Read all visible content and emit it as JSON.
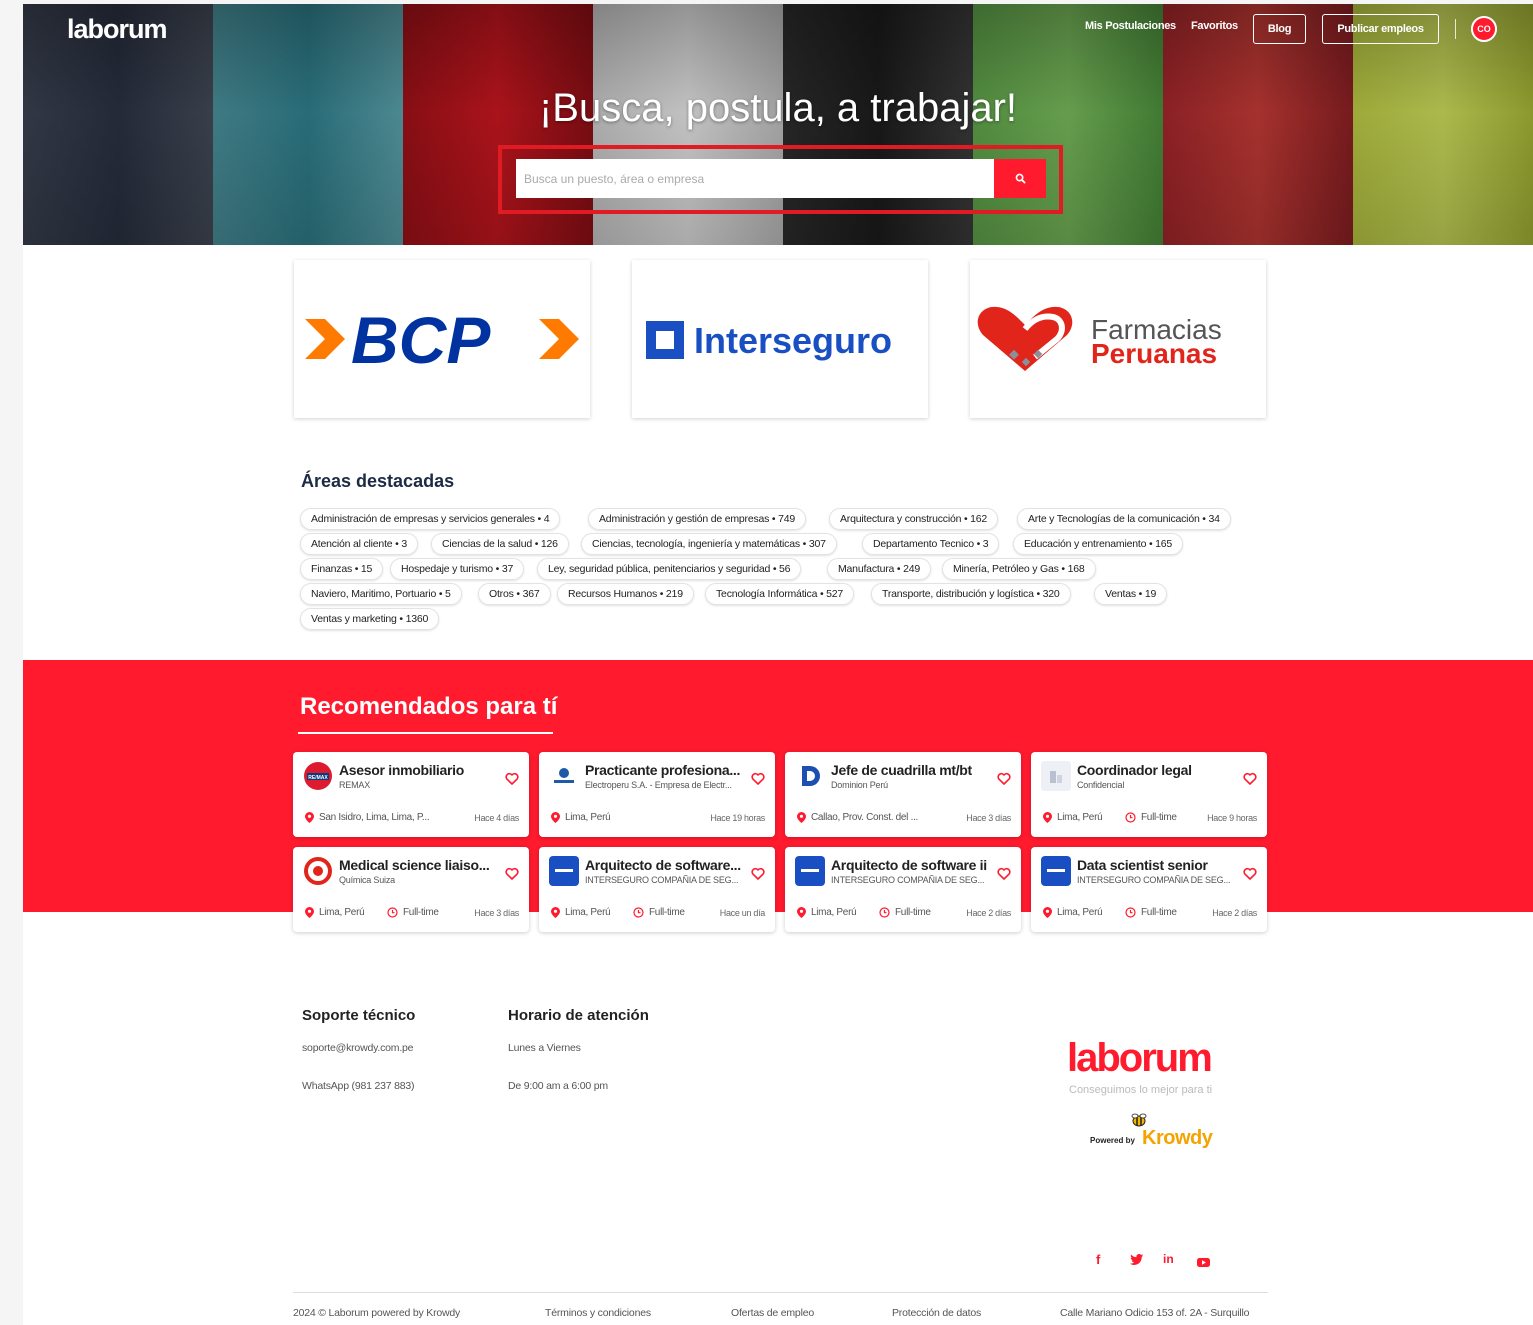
{
  "brand": {
    "name": "laborum",
    "tagline": "Conseguimos lo mejor para ti",
    "powered_by": "Powered by",
    "krowdy": "Krowdy"
  },
  "nav": {
    "applications": "Mis Postulaciones",
    "favorites": "Favoritos",
    "blog": "Blog",
    "publish": "Publicar empleos",
    "avatar_initials": "CO"
  },
  "hero": {
    "title": "¡Busca, postula, a trabajar!",
    "search_placeholder": "Busca un puesto, área o empresa"
  },
  "companies": [
    {
      "name": "BCP",
      "color": "#0033a0",
      "accent": "#ff7a00"
    },
    {
      "name": "Interseguro",
      "color": "#1a4fc4"
    },
    {
      "name_line1": "Farmacias",
      "name_line2": "Peruanas",
      "color": "#e1251b",
      "text_color": "#555555"
    }
  ],
  "areas": {
    "title": "Áreas destacadas",
    "items": [
      "Administración de empresas y servicios generales • 4",
      "Administración y gestión de empresas • 749",
      "Arquitectura y construcción • 162",
      "Arte y Tecnologías de la comunicación • 34",
      "Atención al cliente • 3",
      "Ciencias de la salud • 126",
      "Ciencias, tecnología, ingeniería y matemáticas • 307",
      "Departamento Tecnico • 3",
      "Educación y entrenamiento • 165",
      "Finanzas • 15",
      "Hospedaje y turismo • 37",
      "Ley, seguridad pública, penitenciarios y seguridad • 56",
      "Manufactura • 249",
      "Minería, Petróleo y Gas • 168",
      "Naviero, Maritimo, Portuario • 5",
      "Otros • 367",
      "Recursos Humanos • 219",
      "Tecnología Informática • 527",
      "Transporte, distribución y logística • 320",
      "Ventas • 19",
      "Ventas y marketing • 1360"
    ]
  },
  "recommended": {
    "title": "Recomendados para tí",
    "jobs": [
      {
        "title": "Asesor inmobiliario",
        "company": "REMAX",
        "location": "San Isidro, Lima, Lima, P...",
        "type": "",
        "posted": "Hace 4 días",
        "logo": "remax"
      },
      {
        "title": "Practicante profesiona...",
        "company": "Electroperu S.A. - Empresa de Electr...",
        "location": "Lima, Perú",
        "type": "",
        "posted": "Hace 19 horas",
        "logo": "electroperu"
      },
      {
        "title": "Jefe de cuadrilla mt/bt",
        "company": "Dominion Perú",
        "location": "Callao, Prov. Const. del ...",
        "type": "",
        "posted": "Hace 3 días",
        "logo": "dominion"
      },
      {
        "title": "Coordinador legal",
        "company": "Confidencial",
        "location": "Lima, Perú",
        "type": "Full-time",
        "posted": "Hace 9 horas",
        "logo": "confidencial"
      },
      {
        "title": "Medical science liaiso...",
        "company": "Química Suiza",
        "location": "Lima, Perú",
        "type": "Full-time",
        "posted": "Hace 3 días",
        "logo": "quimica"
      },
      {
        "title": "Arquitecto de software...",
        "company": "INTERSEGURO COMPAÑIA DE SEG...",
        "location": "Lima, Perú",
        "type": "Full-time",
        "posted": "Hace un día",
        "logo": "interseguro"
      },
      {
        "title": "Arquitecto de software ii",
        "company": "INTERSEGURO COMPAÑIA DE SEG...",
        "location": "Lima, Perú",
        "type": "Full-time",
        "posted": "Hace 2 días",
        "logo": "interseguro"
      },
      {
        "title": "Data scientist senior",
        "company": "INTERSEGURO COMPAÑIA DE SEG...",
        "location": "Lima, Perú",
        "type": "Full-time",
        "posted": "Hace 2 días",
        "logo": "interseguro"
      }
    ]
  },
  "footer": {
    "support_title": "Soporte técnico",
    "support_email": "soporte@krowdy.com.pe",
    "support_whatsapp": "WhatsApp (981 237 883)",
    "hours_title": "Horario de atención",
    "hours_days": "Lunes a Viernes",
    "hours_time": "De 9:00 am a 6:00 pm",
    "copyright": "2024 © Laborum powered by Krowdy",
    "terms": "Términos y condiciones",
    "offers": "Ofertas de empleo",
    "privacy": "Protección de datos",
    "address": "Calle Mariano Odicio 153 of. 2A - Surquillo",
    "socials": [
      "facebook-icon",
      "twitter-icon",
      "linkedin-icon",
      "youtube-icon"
    ]
  },
  "colors": {
    "brand_red": "#ff1a2e",
    "outline_red": "#e01b24",
    "heading_navy": "#1d2b45"
  }
}
